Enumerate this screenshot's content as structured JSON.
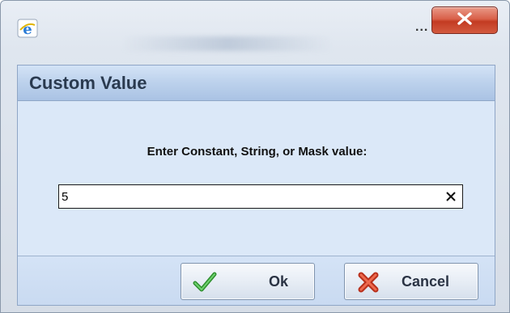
{
  "window": {
    "ellipsis": "...",
    "close_glyph": "X"
  },
  "dialog": {
    "title": "Custom Value",
    "prompt": "Enter Constant, String, or Mask value:",
    "input": {
      "value": "5",
      "placeholder": ""
    },
    "buttons": {
      "ok_label": "Ok",
      "cancel_label": "Cancel"
    }
  },
  "icons": {
    "app": "internet-explorer-icon",
    "close": "close-icon",
    "clear": "clear-icon",
    "ok": "checkmark-icon",
    "cancel": "x-mark-icon"
  },
  "colors": {
    "close_button": "#d35a3f",
    "header_blue": "#bcd1ec",
    "dialog_bg": "#dbe8f8",
    "check_green": "#3aa23a",
    "cancel_red": "#d8402a"
  }
}
